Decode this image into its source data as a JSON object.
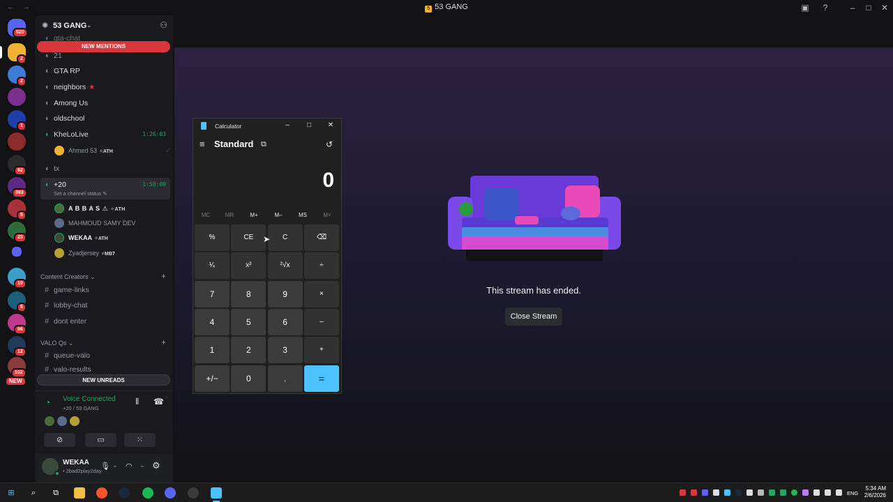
{
  "window": {
    "title": "53 GANG",
    "back_icon": "arrow-left-icon",
    "forward_icon": "arrow-right-icon"
  },
  "rail": {
    "badges": [
      "520",
      "2",
      "2",
      "1",
      "62",
      "393",
      "5",
      "23",
      "19",
      "5",
      "96",
      "12",
      "102"
    ],
    "new_label": "NEW"
  },
  "sidebar": {
    "server_name": "53 GANG",
    "new_mentions": "NEW MENTIONS",
    "new_unreads": "NEW UNREADS",
    "channels": [
      {
        "label": "gta-chat",
        "type": "voice"
      },
      {
        "label": "21",
        "type": "voice"
      },
      {
        "label": "GTA RP",
        "type": "voice"
      },
      {
        "label": "neighbors",
        "type": "voice"
      },
      {
        "label": "Among Us",
        "type": "voice"
      },
      {
        "label": "oldschool",
        "type": "voice"
      },
      {
        "label": "KheLoLive",
        "type": "voice",
        "time": "1:26:03"
      },
      {
        "label": "tx",
        "type": "voice"
      },
      {
        "label": "+20",
        "type": "voice",
        "time": "1:58:09",
        "status": "Set a channel status"
      }
    ],
    "khelolive_users": [
      {
        "name": "Ahmed 53",
        "tag": "✧ATH"
      }
    ],
    "plus20_users": [
      {
        "name": "A B B A S ⚠",
        "tag": "✧ATH"
      },
      {
        "name": "MAHMOUD SAMY DEV",
        "tag": ""
      },
      {
        "name": "WEKAA",
        "tag": "✧ATH"
      },
      {
        "name": "Zyadjersey",
        "tag": "⚡MB7"
      }
    ],
    "categories": [
      {
        "label": "Content Creators",
        "channels": [
          "game-links",
          "lobby-chat",
          "dont enter"
        ]
      },
      {
        "label": "VALO Qs",
        "channels": [
          "queue-valo",
          "valo-results"
        ]
      }
    ]
  },
  "voice_panel": {
    "status": "Voice Connected",
    "channel": "+20 / 53 GANG"
  },
  "user_panel": {
    "name": "WEKAA",
    "status": "• 2bad2play2day"
  },
  "stream": {
    "ended_text": "This stream has ended.",
    "close_button": "Close Stream"
  },
  "calculator": {
    "title": "Calculator",
    "mode": "Standard",
    "display": "0",
    "memory": [
      "MC",
      "MR",
      "M+",
      "M–",
      "MS",
      "M˅"
    ],
    "keys": [
      [
        "%",
        "CE",
        "C",
        "⌫"
      ],
      [
        "¹⁄ₓ",
        "x²",
        "²√x",
        "÷"
      ],
      [
        "7",
        "8",
        "9",
        "×"
      ],
      [
        "4",
        "5",
        "6",
        "–"
      ],
      [
        "1",
        "2",
        "3",
        "+"
      ],
      [
        "+/−",
        "0",
        ".",
        "="
      ]
    ]
  },
  "taskbar": {
    "time": "5:34 AM",
    "date": "2/6/2026",
    "language": "ENG"
  },
  "colors": {
    "accent_green": "#23a55a",
    "mention_red": "#da373c",
    "calc_equals": "#4cc2ff"
  }
}
